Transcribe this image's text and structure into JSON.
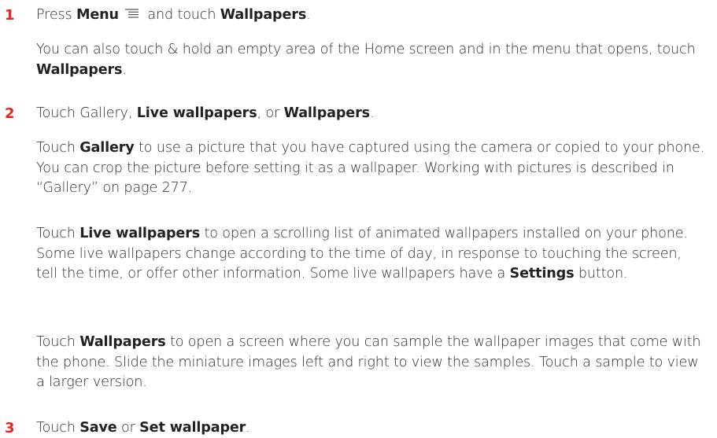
{
  "steps": [
    {
      "number": "1",
      "pre": "Press ",
      "menu": "Menu",
      "mid": " and touch ",
      "wallpapers": "Wallpapers",
      "post": ".",
      "note": {
        "text": "You can also touch & hold an empty area of the Home screen and in the menu that opens, touch ",
        "wallpapers": "Wallpapers",
        "post": "."
      }
    },
    {
      "number": "2",
      "pre": "Touch Gallery, ",
      "live": "Live wallpapers",
      "mid": ", or ",
      "wallpapers": "Wallpapers",
      "post": ".",
      "gallery": {
        "pre": "Touch ",
        "term": "Gallery",
        "text": " to use a picture that you have captured using the camera or copied to your phone. You can crop the picture before setting it as a wallpaper. Working with pictures is described in “Gallery” on page 277."
      },
      "live_para": {
        "pre": "Touch ",
        "term": "Live wallpapers",
        "text": " to open a scrolling list of animated wallpapers installed on your phone. Some live wallpapers change according to the time of day, in response to touching the screen, tell the time, or offer other information. Some live wallpapers have a ",
        "settings": "Settings",
        "post": " button."
      },
      "wall_para": {
        "pre": "Touch ",
        "term": "Wallpapers",
        "text": " to open a screen where you can sample the wallpaper images that come with the phone. Slide the miniature images left and right to view the samples. Touch a sample to view a larger version."
      }
    },
    {
      "number": "3",
      "pre": "Touch ",
      "save": "Save",
      "mid": " or ",
      "set": "Set wallpaper",
      "post": "."
    }
  ],
  "icons": {
    "menu": "menu-icon"
  },
  "colors": {
    "step_number": "#e8231e",
    "text": "#2b2b2b"
  }
}
